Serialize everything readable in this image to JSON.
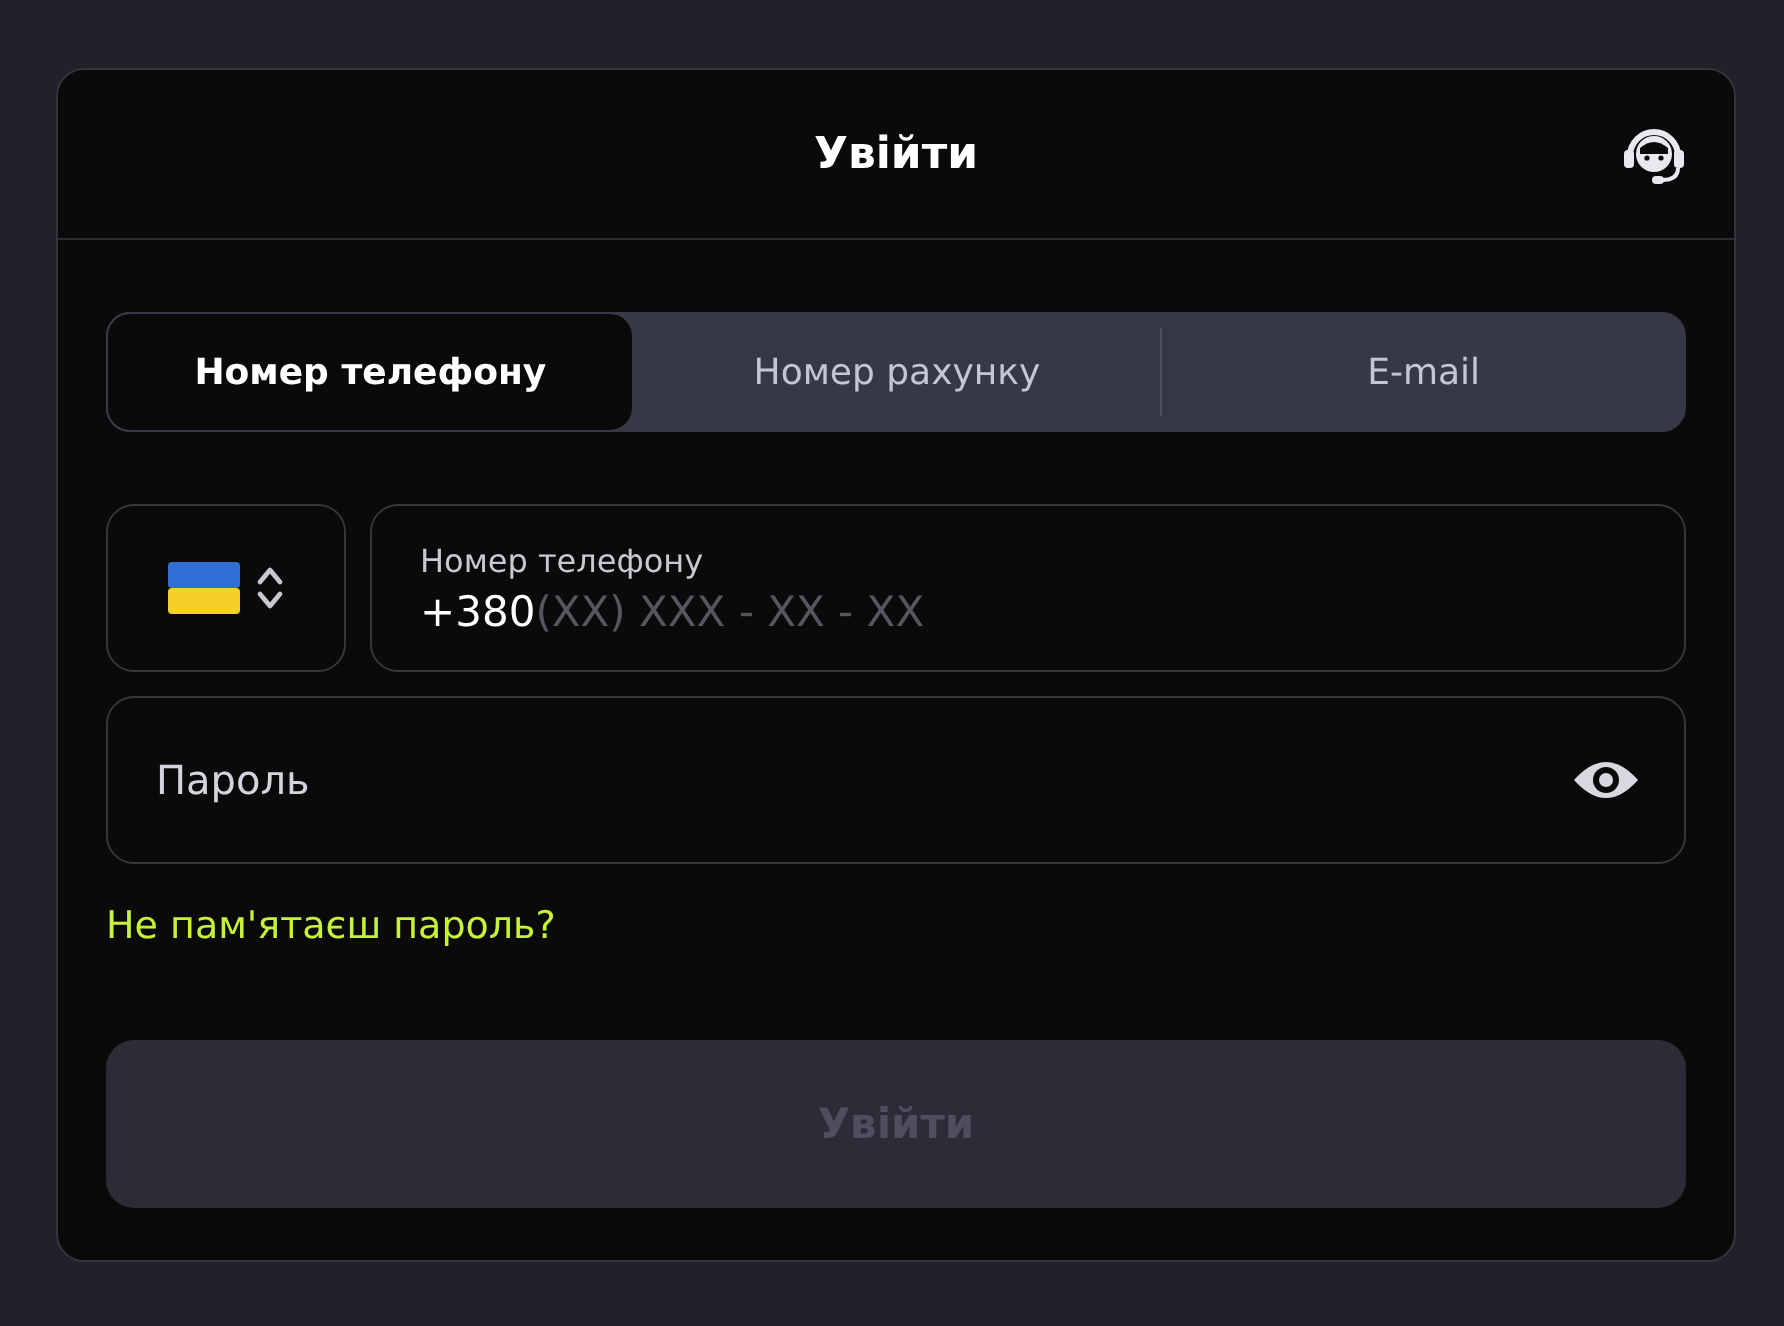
{
  "header": {
    "title": "Увійти"
  },
  "tabs": [
    {
      "label": "Номер телефону",
      "selected": true
    },
    {
      "label": "Номер рахунку",
      "selected": false
    },
    {
      "label": "E-mail",
      "selected": false
    }
  ],
  "phone": {
    "label": "Номер телефону",
    "prefix": "+380",
    "placeholder": "(XX) XXX - XX - XX"
  },
  "password": {
    "placeholder": "Пароль"
  },
  "forgot_link": "Не пам'ятаєш пароль?",
  "submit": {
    "label": "Увійти",
    "disabled": true
  }
}
